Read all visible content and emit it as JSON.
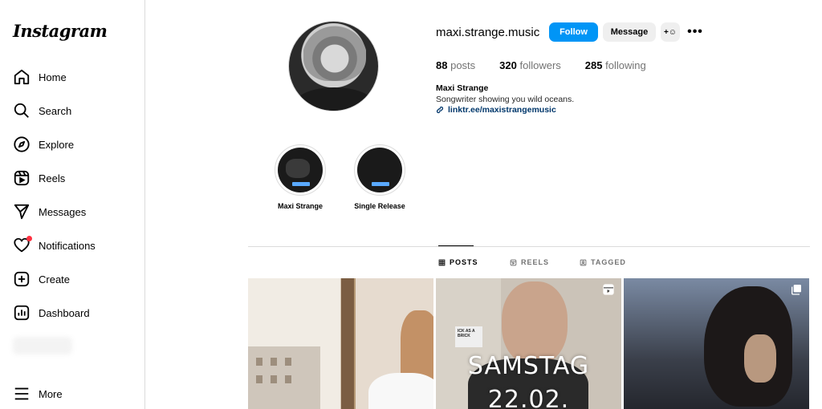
{
  "app": {
    "logo": "Instagram"
  },
  "sidebar": {
    "items": [
      {
        "label": "Home",
        "icon": "home-icon"
      },
      {
        "label": "Search",
        "icon": "search-icon"
      },
      {
        "label": "Explore",
        "icon": "compass-icon"
      },
      {
        "label": "Reels",
        "icon": "reels-icon"
      },
      {
        "label": "Messages",
        "icon": "send-icon"
      },
      {
        "label": "Notifications",
        "icon": "heart-icon"
      },
      {
        "label": "Create",
        "icon": "plus-square-icon"
      },
      {
        "label": "Dashboard",
        "icon": "chart-icon"
      }
    ],
    "more_label": "More",
    "notification_dot_color": "#ff3040"
  },
  "profile": {
    "username": "maxi.strange.music",
    "follow_label": "Follow",
    "message_label": "Message",
    "add_user_label": "+☺",
    "more_label": "•••",
    "stats": {
      "posts_count": "88",
      "posts_label": "posts",
      "followers_count": "320",
      "followers_label": "followers",
      "following_count": "285",
      "following_label": "following"
    },
    "bio_name": "Maxi Strange",
    "bio_text": "Songwriter showing you wild oceans.",
    "link": "linktr.ee/maxistrangemusic",
    "accent_color": "#0095f6"
  },
  "highlights": [
    {
      "title": "Maxi Strange"
    },
    {
      "title": "Single Release"
    }
  ],
  "tabs": [
    {
      "label": "POSTS",
      "icon": "grid-icon",
      "active": true
    },
    {
      "label": "REELS",
      "icon": "reels-icon",
      "active": false
    },
    {
      "label": "TAGGED",
      "icon": "tagged-icon",
      "active": false
    }
  ],
  "posts": [
    {
      "type": "photo"
    },
    {
      "type": "reel",
      "sign_text": "ICK AS A BRICK",
      "overlay_line1": "SAMSTAG",
      "overlay_line2": "22.02.",
      "corner_icon": "reel-icon"
    },
    {
      "type": "carousel",
      "corner_icon": "carousel-icon"
    }
  ]
}
